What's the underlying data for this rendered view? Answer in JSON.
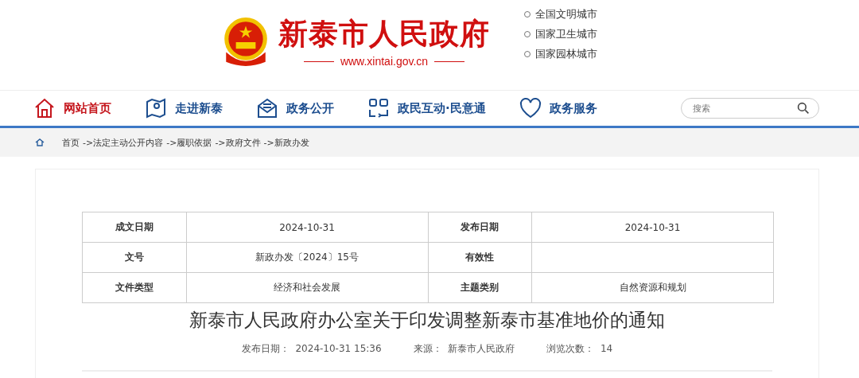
{
  "header": {
    "site_name": "新泰市人民政府",
    "url": "www.xintai.gov.cn",
    "honors": [
      "全国文明城市",
      "国家卫生城市",
      "国家园林城市"
    ]
  },
  "nav": [
    {
      "label": "网站首页",
      "selected": true
    },
    {
      "label": "走进新泰",
      "selected": false
    },
    {
      "label": "政务公开",
      "selected": false
    },
    {
      "label": "政民互动·民意通",
      "selected": false
    },
    {
      "label": "政务服务",
      "selected": false
    }
  ],
  "search": {
    "placeholder": "搜索"
  },
  "breadcrumb": [
    "首页",
    "->法定主动公开内容",
    "->履职依据",
    "->政府文件",
    "->新政办发"
  ],
  "info_table": [
    [
      {
        "label": "成文日期",
        "value": "2024-10-31"
      },
      {
        "label": "发布日期",
        "value": "2024-10-31"
      }
    ],
    [
      {
        "label": "文号",
        "value": "新政办发〔2024〕15号"
      },
      {
        "label": "有效性"
      }
    ],
    [
      {
        "label": "文件类型",
        "value": "经济和社会发展"
      },
      {
        "label": "主题类别",
        "value": "自然资源和规划"
      }
    ]
  ],
  "article": {
    "title": "新泰市人民政府办公室关于印发调整新泰市基准地价的通知",
    "meta": [
      {
        "label": "发布日期：",
        "value": "2024-10-31 15:36"
      },
      {
        "label": "来源：",
        "value": "新泰市人民政府"
      },
      {
        "label": "浏览次数：",
        "value": "14"
      }
    ]
  }
}
